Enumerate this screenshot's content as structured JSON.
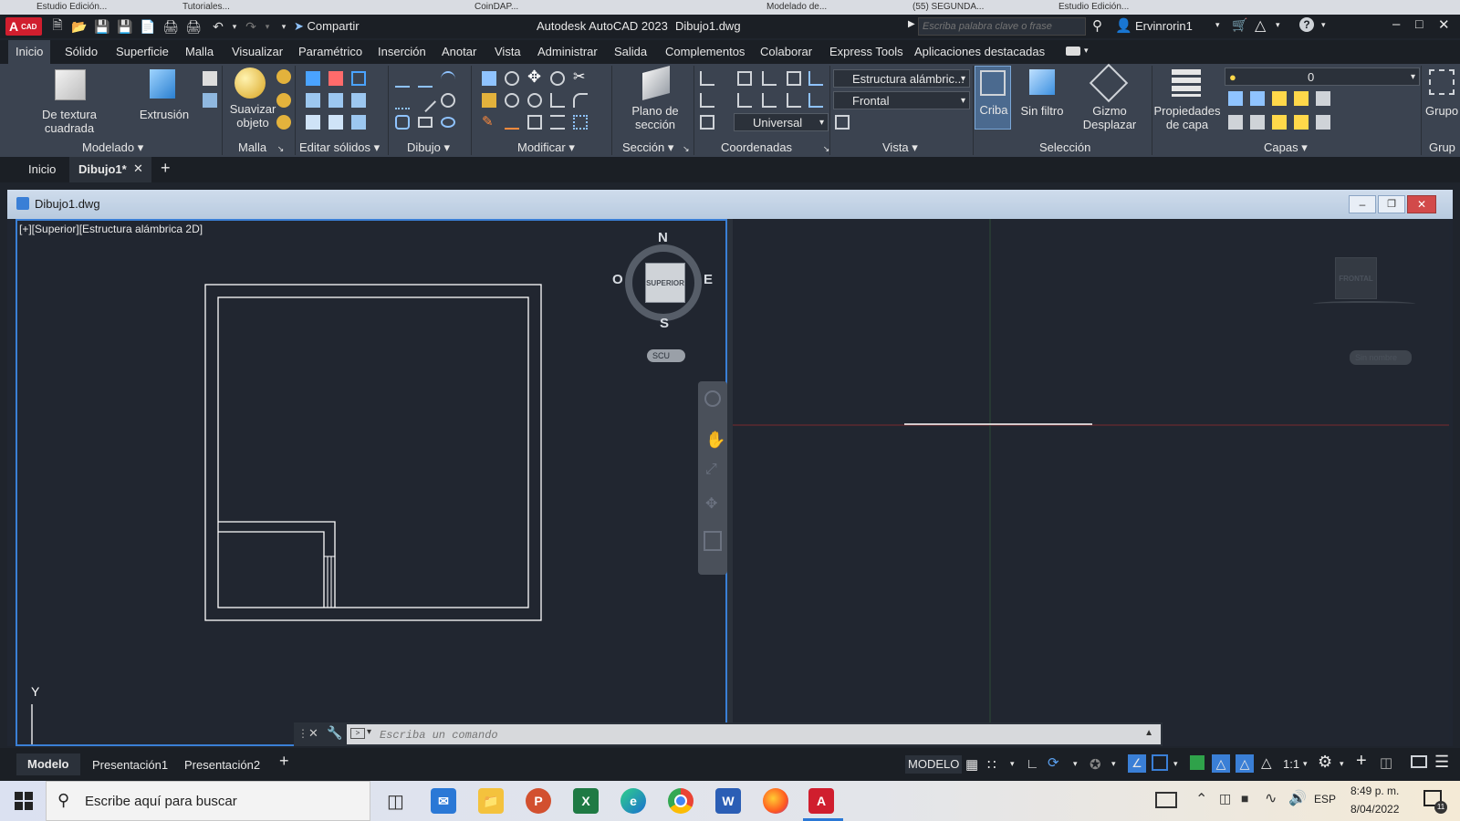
{
  "browser_tabs": [
    "Estudio Edición...",
    "Tutoriales...",
    "CoinDAP...",
    "Modelado de...",
    "(55) SEGUNDA...",
    "Estudio Edición..."
  ],
  "titlebar": {
    "logo_a": "A",
    "logo_cad": "CAD",
    "share_label": "Compartir",
    "app_title": "Autodesk AutoCAD 2023",
    "doc_title": "Dibujo1.dwg",
    "search_placeholder": "Escriba palabra clave o frase",
    "user": "Ervinrorin1"
  },
  "ribbon_tabs": [
    "Inicio",
    "Sólido",
    "Superficie",
    "Malla",
    "Visualizar",
    "Paramétrico",
    "Inserción",
    "Anotar",
    "Vista",
    "Administrar",
    "Salida",
    "Complementos",
    "Colaborar",
    "Express Tools",
    "Aplicaciones destacadas"
  ],
  "ribbon": {
    "big_buttons": {
      "box": "De textura cuadrada",
      "extrude": "Extrusión",
      "smooth": "Suavizar objeto",
      "section_plane": "Plano de sección",
      "filter": "Sin filtro",
      "gizmo": "Gizmo Desplazar",
      "layer_props": "Propiedades de capa",
      "criba": "Criba",
      "group": "Grupo"
    },
    "combos": {
      "visual_style": "Estructura alámbric...",
      "view": "Frontal",
      "ucs": "Universal",
      "layer": "0"
    },
    "groups": [
      "Modelado",
      "Malla",
      "Editar sólidos",
      "Dibujo",
      "Modificar",
      "Sección",
      "Coordenadas",
      "Vista",
      "Selección",
      "Capas",
      "Grup"
    ]
  },
  "file_tabs": {
    "start": "Inicio",
    "current": "Dibujo1*",
    "new": "+"
  },
  "document": {
    "title": "Dibujo1.dwg",
    "viewport_label": "[+][Superior][Estructura alámbrica 2D]",
    "viewcube": {
      "n": "N",
      "s": "S",
      "e": "E",
      "w": "O",
      "face": "SUPERIOR",
      "ucs": "SCU"
    },
    "viewcube2": {
      "face": "FRONTAL",
      "ucs": "Sin nombre"
    },
    "axis_y": "Y"
  },
  "command_line": {
    "placeholder": "Escriba un comando"
  },
  "layout_tabs": [
    "Modelo",
    "Presentación1",
    "Presentación2",
    "+"
  ],
  "status": {
    "mode": "MODELO",
    "scale": "1:1"
  },
  "taskbar": {
    "search_placeholder": "Escribe aquí para buscar",
    "lang": "ESP",
    "time": "8:49 p. m.",
    "date": "8/04/2022",
    "notif": "11"
  },
  "colors": {
    "accent": "#3a7fd6",
    "autocad_red": "#d01e2e",
    "ribbon_bg": "#3b4350",
    "canvas_bg": "#212630"
  }
}
